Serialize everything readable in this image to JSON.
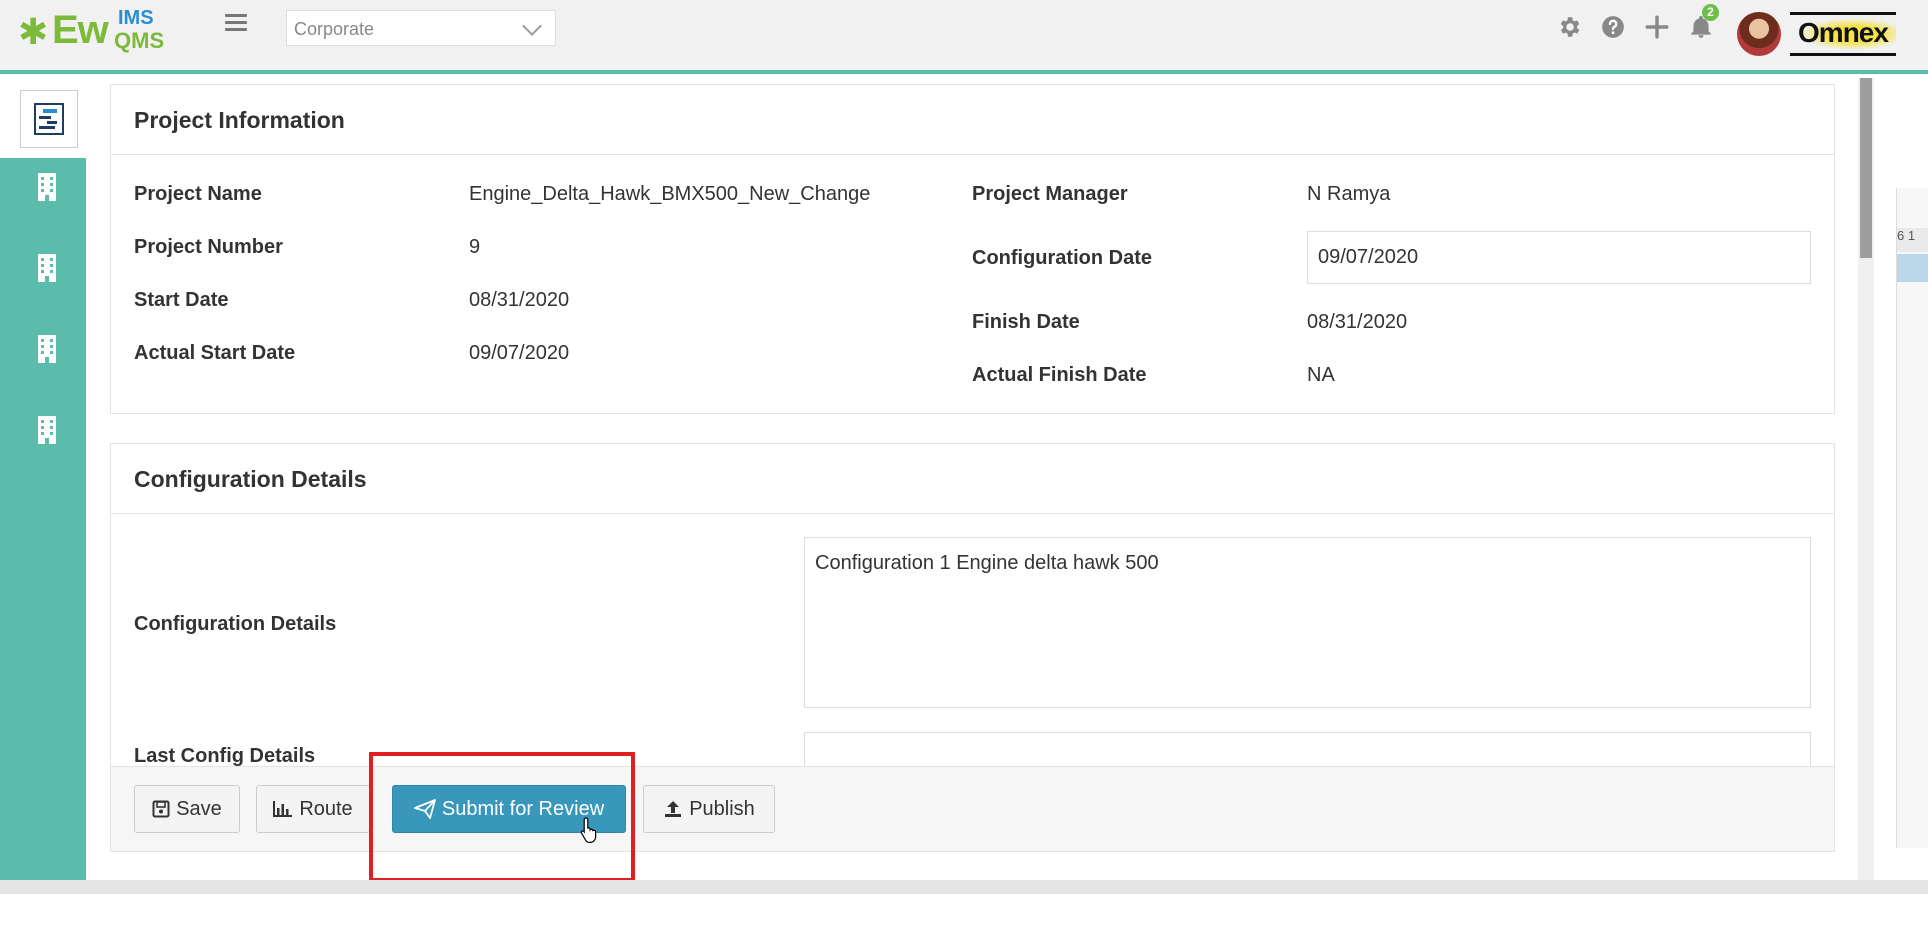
{
  "app": {
    "logo": {
      "main": "Ew",
      "superscript": "IMS",
      "subscript": "QMS"
    },
    "company_select": {
      "value": "Corporate"
    },
    "notifications_count": "2",
    "brand_logo_text": "Omnex",
    "colors": {
      "accent": "#5bbcab",
      "primary_button": "#3897ba",
      "highlight": "#e02020",
      "logo_green": "#7cba3a",
      "logo_blue": "#2a8fd0"
    }
  },
  "header_icons": [
    "gear-icon",
    "help-icon",
    "plus-icon",
    "bell-icon"
  ],
  "sidebar": {
    "items": [
      {
        "icon": "project-schedule-icon",
        "active": true
      },
      {
        "icon": "building-icon"
      },
      {
        "icon": "building-icon"
      },
      {
        "icon": "building-icon"
      },
      {
        "icon": "building-icon"
      }
    ]
  },
  "project_info": {
    "title": "Project Information",
    "fields": {
      "project_name": {
        "label": "Project Name",
        "value": "Engine_Delta_Hawk_BMX500_New_Change"
      },
      "project_number": {
        "label": "Project Number",
        "value": "9"
      },
      "start_date": {
        "label": "Start Date",
        "value": "08/31/2020"
      },
      "actual_start_date": {
        "label": "Actual Start Date",
        "value": "09/07/2020"
      },
      "project_manager": {
        "label": "Project Manager",
        "value": "N Ramya"
      },
      "configuration_date": {
        "label": "Configuration Date",
        "value": "09/07/2020"
      },
      "finish_date": {
        "label": "Finish Date",
        "value": "08/31/2020"
      },
      "actual_finish_date": {
        "label": "Actual Finish Date",
        "value": "NA"
      }
    }
  },
  "config_details": {
    "title": "Configuration Details",
    "details_label": "Configuration Details",
    "details_value": "Configuration 1 Engine delta hawk 500",
    "last_label": "Last Config Details",
    "last_value": ""
  },
  "actions": {
    "save": "Save",
    "route": "Route",
    "submit": "Submit for Review",
    "publish": "Publish"
  },
  "right_panel": {
    "header_text": "6 1"
  }
}
